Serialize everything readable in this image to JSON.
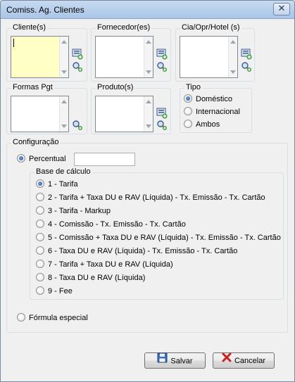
{
  "window": {
    "title": "Comiss. Ag. Clientes",
    "close_glyph": "✕"
  },
  "groups": {
    "clientes": {
      "label": "Cliente(s)"
    },
    "fornecedor": {
      "label": "Fornecedor(es)"
    },
    "cia": {
      "label": "Cia/Opr/Hotel (s)"
    },
    "formas": {
      "label": "Formas Pgt"
    },
    "produto": {
      "label": "Produto(s)"
    }
  },
  "tipo": {
    "label": "Tipo",
    "options": [
      "Doméstico",
      "Internacional",
      "Ambos"
    ],
    "selected": 0
  },
  "configuracao": {
    "label": "Configuração",
    "percentual_label": "Percentual",
    "percentual_value": "",
    "base": {
      "label": "Base de cálculo",
      "options": [
        "1 - Tarifa",
        "2 - Tarifa + Taxa DU e RAV (Líquida) - Tx. Emissão - Tx. Cartão",
        "3 - Tarifa - Markup",
        "4 - Comissão - Tx. Emissão - Tx. Cartão",
        "5 - Comissão + Taxa DU e RAV (Líquida) - Tx. Emissão - Tx. Cartão",
        "6 - Taxa DU e RAV (Líquida) - Tx. Emissão - Tx. Cartão",
        "7 - Tarifa + Taxa DU e RAV (Líquida)",
        "8 - Taxa DU e RAV (Líquida)",
        "9 - Fee"
      ],
      "selected": 0
    },
    "formula_label": "Fórmula especial"
  },
  "buttons": {
    "save": "Salvar",
    "cancel": "Cancelar"
  },
  "colors": {
    "highlight_list": "#ffffc6",
    "accent": "#1b4fa4"
  },
  "icons": [
    "search-add-icon",
    "list-add-icon",
    "save-disk-icon",
    "cancel-x-icon"
  ]
}
